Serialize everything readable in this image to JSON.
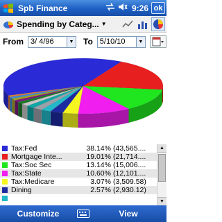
{
  "titlebar": {
    "title": "Spb Finance",
    "time": "9:26",
    "ok_label": "ok"
  },
  "toolbar": {
    "report_name": "Spending by Categ..."
  },
  "dates": {
    "from_label": "From",
    "from_value": "3/ 4/96",
    "to_label": "To",
    "to_value": "5/10/10"
  },
  "chart_data": {
    "type": "pie",
    "slices": [
      {
        "label": "Tax:Fed",
        "percent": 38.14,
        "color": "#2a2ad6"
      },
      {
        "label": "Mortgage Inte...",
        "percent": 19.01,
        "color": "#e81f1f"
      },
      {
        "label": "Tax:Soc Sec",
        "percent": 13.14,
        "color": "#1fe61f"
      },
      {
        "label": "Tax:State",
        "percent": 10.6,
        "color": "#f01ff0"
      },
      {
        "label": "Tax:Medicare",
        "percent": 3.07,
        "color": "#f5f51f"
      },
      {
        "label": "Dining",
        "percent": 2.57,
        "color": "#1e2aa0"
      },
      {
        "label": "",
        "percent": 2.0,
        "color": "#22b8c8"
      },
      {
        "label": "",
        "percent": 1.9,
        "color": "#9aa0a8"
      },
      {
        "label": "",
        "percent": 1.7,
        "color": "#10a6a6"
      },
      {
        "label": "",
        "percent": 1.5,
        "color": "#c6c6c6"
      },
      {
        "label": "",
        "percent": 1.3,
        "color": "#1c7a2a"
      },
      {
        "label": "",
        "percent": 1.2,
        "color": "#7a1c7a"
      },
      {
        "label": "",
        "percent": 1.1,
        "color": "#a0a01c"
      },
      {
        "label": "",
        "percent": 1.0,
        "color": "#3a8ad8"
      },
      {
        "label": "",
        "percent": 0.9,
        "color": "#d87a3a"
      }
    ]
  },
  "legend": [
    {
      "category": "Tax:Fed",
      "percent": "38.14%",
      "amount": "(43,565....",
      "color": "#2a2ad6"
    },
    {
      "category": "Mortgage Inte...",
      "percent": "19.01%",
      "amount": "(21,714....",
      "color": "#e81f1f"
    },
    {
      "category": "Tax:Soc Sec",
      "percent": "13.14%",
      "amount": "(15,006....",
      "color": "#1fe61f"
    },
    {
      "category": "Tax:State",
      "percent": "10.60%",
      "amount": "(12,101....",
      "color": "#f01ff0"
    },
    {
      "category": "Tax:Medicare",
      "percent": "3.07%",
      "amount": "(3,509.58)",
      "color": "#f5f51f"
    },
    {
      "category": "Dining",
      "percent": "2.57%",
      "amount": "(2,930.12)",
      "color": "#1e2aa0"
    },
    {
      "category": "",
      "percent": "",
      "amount": "",
      "color": "#22b8c8"
    }
  ],
  "menubar": {
    "left_label": "Customize",
    "right_label": "View"
  }
}
